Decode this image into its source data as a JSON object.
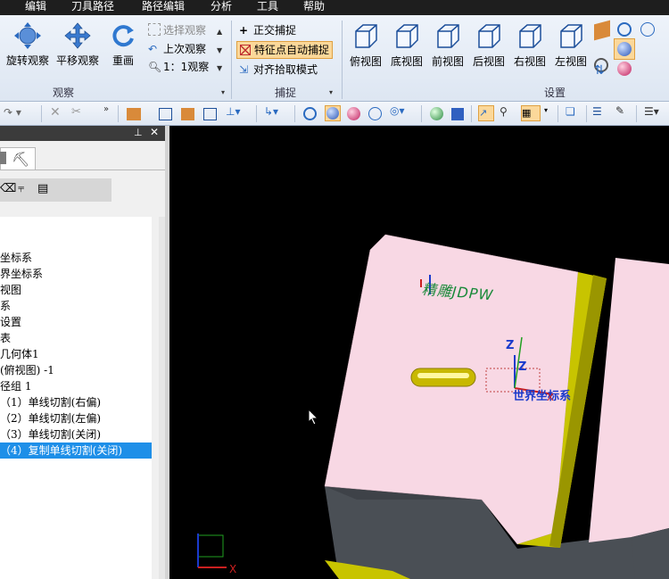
{
  "menu": [
    "编辑",
    "刀具路径",
    "路径编辑",
    "分析",
    "工具",
    "帮助"
  ],
  "ribbon": {
    "observe": {
      "group_label": "观察",
      "rotate": "旋转观察",
      "pan": "平移观察",
      "redraw": "重画",
      "select_view": "选择观察",
      "last_view": "上次观察",
      "one_to_one": "1：1观察"
    },
    "capture": {
      "group_label": "捕捉",
      "ortho": "正交捕捉",
      "feature_point": "特征点自动捕捉",
      "align_pick": "对齐拾取模式"
    },
    "settings": {
      "group_label": "设置",
      "views": [
        "俯视图",
        "底视图",
        "前视图",
        "后视图",
        "右视图",
        "左视图"
      ]
    }
  },
  "tree": {
    "items": [
      "坐标系",
      "界坐标系",
      "视图",
      "系",
      "设置",
      "表",
      "几何体1",
      "(俯视图) -1",
      "径组 1",
      "（1）单线切割(右偏)",
      "（2）单线切割(左偏)",
      "（3）单线切割(关闭)",
      "（4）复制单线切割(关闭)"
    ],
    "selected_index": 12
  },
  "viewport": {
    "world_cs_label": "世界坐标系",
    "axis_z": "Z",
    "axis_x": "X",
    "engraving_text": "精雕JDPW",
    "corner_axis_x": "X"
  },
  "colors": {
    "part_face": "#f8d8e4",
    "part_side": "#4a4f55",
    "slot_yellow": "#c8c400",
    "selection": "#1e8fe8",
    "ribbon_active": "#fbd89a"
  }
}
